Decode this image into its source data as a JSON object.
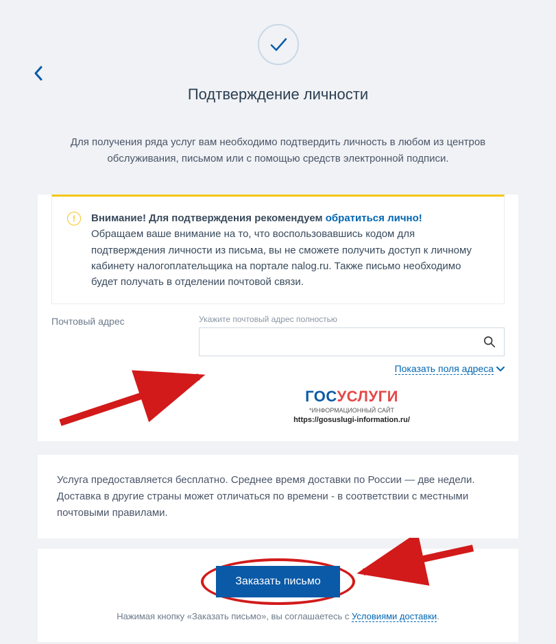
{
  "page": {
    "title": "Подтверждение личности",
    "intro": "Для получения ряда услуг вам необходимо подтвердить личность в любом из центров обслуживания, письмом или с помощью средств электронной подписи."
  },
  "warning": {
    "prefix": "Внимание! Для подтверждения рекомендуем ",
    "link": "обратиться лично!",
    "body": "Обращаем ваше внимание на то, что воспользовавшись кодом для подтверждения личности из письма, вы не сможете получить доступ к личному кабинету налогоплательщика на портале nalog.ru. Также письмо необходимо будет получать в отделении почтовой связи."
  },
  "form": {
    "label": "Почтовый адрес",
    "hint": "Укажите почтовый адрес полностью",
    "input_value": "",
    "show_fields": "Показать поля адреса"
  },
  "brand": {
    "part1": "ГОС",
    "part2": "УСЛУГИ",
    "sub1": "*ИНФОРМАЦИОННЫЙ САЙТ",
    "sub2": "https://gosuslugi-information.ru/"
  },
  "info": {
    "text": "Услуга предоставляется бесплатно. Среднее время доставки по России — две недели. Доставка в другие страны может отличаться по времени - в соответствии с местными почтовыми правилами."
  },
  "action": {
    "button": "Заказать письмо",
    "agree_prefix": "Нажимая кнопку «Заказать письмо», вы соглашаетесь с ",
    "agree_link": "Условиями доставки"
  }
}
